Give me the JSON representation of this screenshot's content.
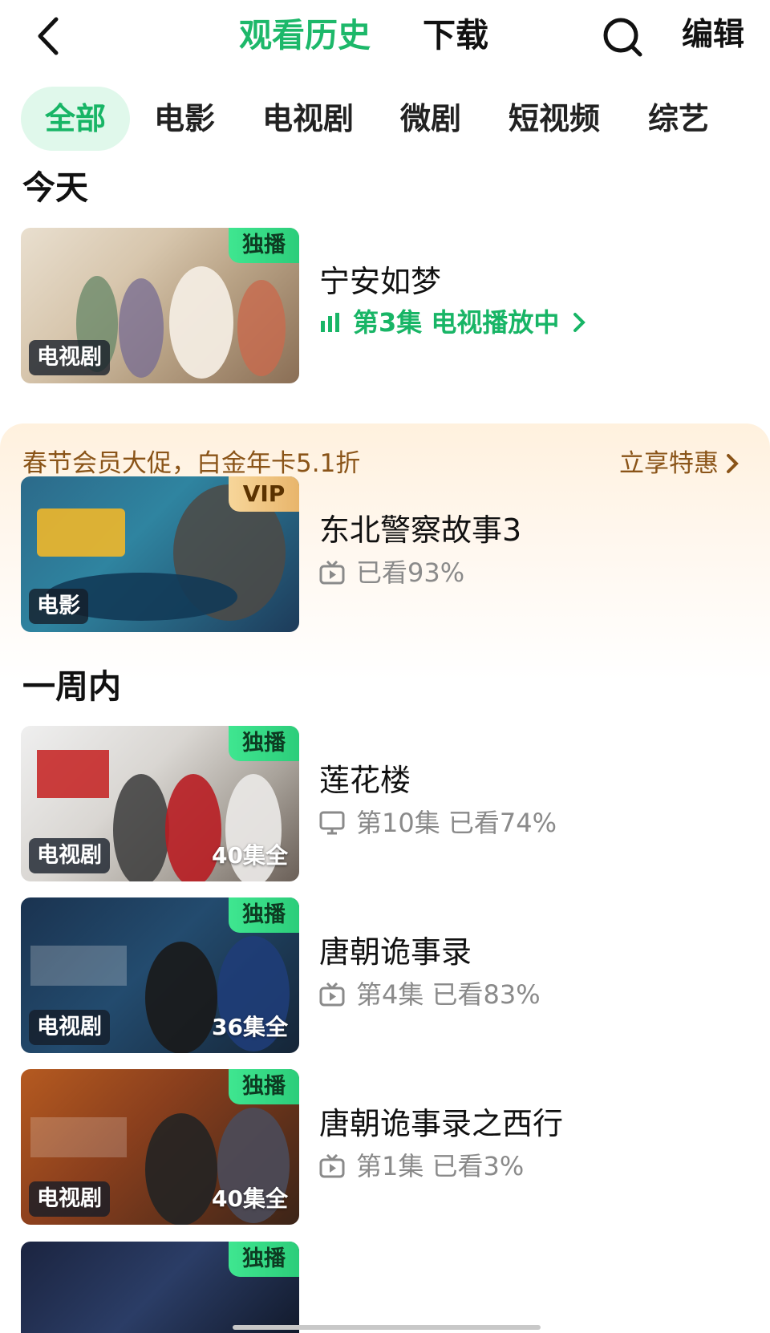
{
  "header": {
    "tabs": [
      "观看历史",
      "下载"
    ],
    "edit_label": "编辑",
    "accent_color": "#1db86a"
  },
  "categories": [
    "全部",
    "电影",
    "电视剧",
    "微剧",
    "短视频",
    "综艺"
  ],
  "sections": {
    "today": "今天",
    "week": "一周内"
  },
  "promo": {
    "text": "春节会员大促，白金年卡5.1折",
    "action": "立享特惠"
  },
  "items": [
    {
      "title": "宁安如梦",
      "badge": "独播",
      "type": "电视剧",
      "status": "第3集 电视播放中",
      "icon": "bars-playing-icon"
    },
    {
      "title": "东北警察故事3",
      "badge": "VIP",
      "type": "电影",
      "status": "已看93%",
      "icon": "tv-icon"
    },
    {
      "title": "莲花楼",
      "badge": "独播",
      "type": "电视剧",
      "count": "40集全",
      "status": "第10集 已看74%",
      "icon": "monitor-icon"
    },
    {
      "title": "唐朝诡事录",
      "badge": "独播",
      "type": "电视剧",
      "count": "36集全",
      "status": "第4集 已看83%",
      "icon": "tv-icon"
    },
    {
      "title": "唐朝诡事录之西行",
      "badge": "独播",
      "type": "电视剧",
      "count": "40集全",
      "status": "第1集 已看3%",
      "icon": "tv-icon"
    },
    {
      "badge": "独播"
    }
  ]
}
